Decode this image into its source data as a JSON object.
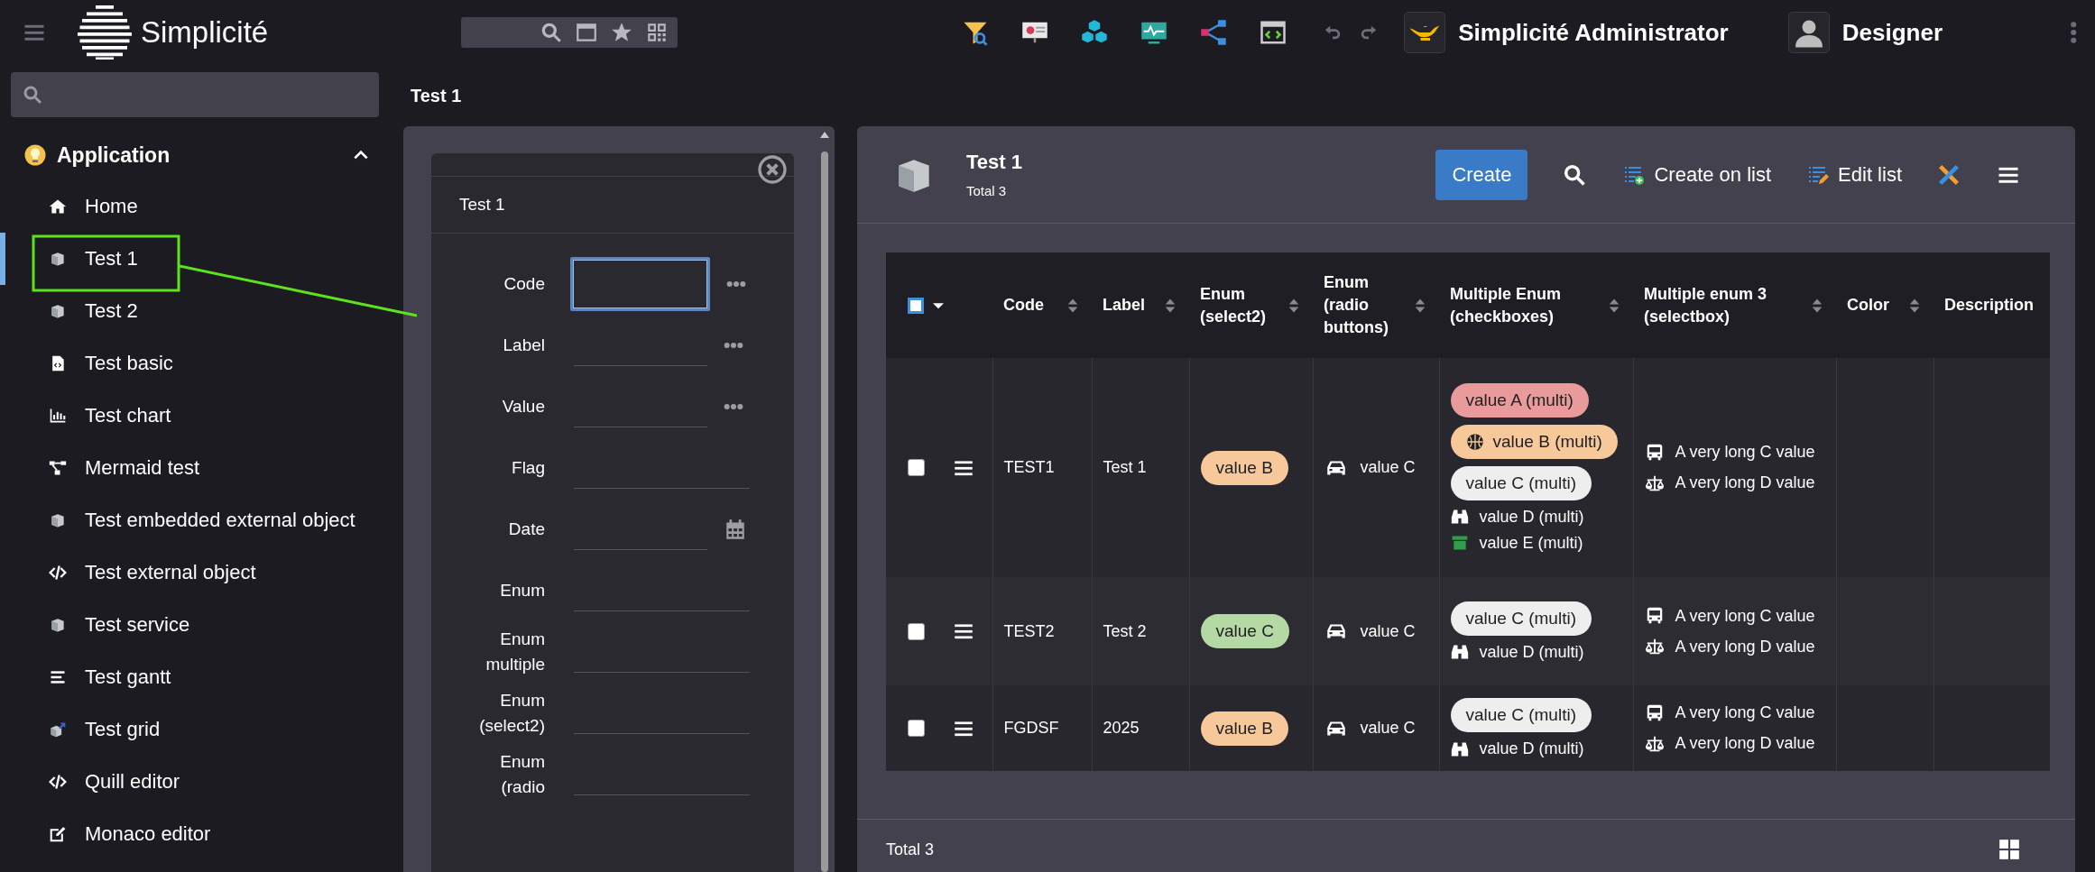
{
  "topbar": {
    "app_name": "Simplicité",
    "user_role": "Simplicité Administrator",
    "user_name": "Designer"
  },
  "sidebar": {
    "section": {
      "label": "Application",
      "expanded": true
    },
    "items": [
      {
        "label": "Home",
        "kind": "home",
        "selected": false
      },
      {
        "label": "Test 1",
        "kind": "cube",
        "selected": true
      },
      {
        "label": "Test 2",
        "kind": "cube",
        "selected": false
      },
      {
        "label": "Test basic",
        "kind": "file-code",
        "selected": false
      },
      {
        "label": "Test chart",
        "kind": "chart",
        "selected": false
      },
      {
        "label": "Mermaid test",
        "kind": "diagram",
        "selected": false
      },
      {
        "label": "Test embedded external object",
        "kind": "cube",
        "selected": false
      },
      {
        "label": "Test external object",
        "kind": "code",
        "selected": false
      },
      {
        "label": "Test service",
        "kind": "cube",
        "selected": false
      },
      {
        "label": "Test gantt",
        "kind": "gantt",
        "selected": false
      },
      {
        "label": "Test grid",
        "kind": "cube-arrow",
        "selected": false
      },
      {
        "label": "Quill editor",
        "kind": "code",
        "selected": false
      },
      {
        "label": "Monaco editor",
        "kind": "edit",
        "selected": false
      }
    ]
  },
  "breadcrumb": "Test 1",
  "form": {
    "title": "Test 1",
    "fields": [
      {
        "label": "Code",
        "focused": true,
        "kind": "more"
      },
      {
        "label": "Label",
        "focused": false,
        "kind": "more"
      },
      {
        "label": "Value",
        "focused": false,
        "kind": "more"
      },
      {
        "label": "Flag",
        "focused": false,
        "kind": "plain"
      },
      {
        "label": "Date",
        "focused": false,
        "kind": "calendar"
      },
      {
        "label": "Enum",
        "focused": false,
        "kind": "plain"
      },
      {
        "label": "Enum multiple",
        "focused": false,
        "kind": "plain"
      },
      {
        "label": "Enum (select2)",
        "focused": false,
        "kind": "plain"
      },
      {
        "label": "Enum (radio",
        "focused": false,
        "kind": "plain"
      }
    ]
  },
  "list": {
    "title": "Test 1",
    "count": "Total 3",
    "actions": [
      {
        "kind": "primary",
        "label": "Create"
      },
      {
        "kind": "search"
      },
      {
        "kind": "addlist",
        "label": "Create on list"
      },
      {
        "kind": "editlist",
        "label": "Edit list"
      },
      {
        "kind": "tools"
      },
      {
        "kind": "menu"
      }
    ],
    "select_all": {
      "checked": false
    },
    "columns": [
      {
        "label": "Code",
        "sortable": true
      },
      {
        "label": "Label",
        "sortable": true
      },
      {
        "label": "Enum (select2)",
        "sortable": true
      },
      {
        "label": "Enum (radio buttons)",
        "sortable": true
      },
      {
        "label": "Multiple Enum (checkboxes)",
        "sortable": true
      },
      {
        "label": "Multiple enum 3 (selectbox)",
        "sortable": true
      },
      {
        "label": "Color",
        "sortable": true
      },
      {
        "label": "Description",
        "sortable": false
      }
    ],
    "rows": [
      {
        "checked": false,
        "code": "TEST1",
        "label": "Test 1",
        "enum_select2": {
          "text": "value B",
          "color": "#f7c99a"
        },
        "enum_radio": {
          "text": "value C",
          "kind": "car"
        },
        "multiple_enum": [
          {
            "kind": "tag",
            "text": "value A (multi)",
            "color": "#e99b9b"
          },
          {
            "kind": "ball",
            "text": "value B (multi)",
            "color": "#f7c99a"
          },
          {
            "kind": "tag",
            "text": "value C (multi)",
            "color": "#eeeeee"
          },
          {
            "kind": "binoculars",
            "text": "value D (multi)"
          },
          {
            "kind": "archive",
            "text": "value E (multi)"
          }
        ],
        "multiple_enum_3": [
          {
            "text": "A very long C value",
            "kind": "bus"
          },
          {
            "text": "A very long D value",
            "kind": "scale"
          }
        ]
      },
      {
        "checked": false,
        "code": "TEST2",
        "label": "Test 2",
        "enum_select2": {
          "text": "value C",
          "color": "#b5d9a5"
        },
        "enum_radio": {
          "text": "value C",
          "kind": "car"
        },
        "multiple_enum": [
          {
            "kind": "tag",
            "text": "value C (multi)",
            "color": "#eeeeee"
          },
          {
            "kind": "binoculars",
            "text": "value D (multi)"
          }
        ],
        "multiple_enum_3": [
          {
            "text": "A very long C value",
            "kind": "bus"
          },
          {
            "text": "A very long D value",
            "kind": "scale"
          }
        ]
      },
      {
        "checked": false,
        "code": "FGDSF",
        "label": "2025",
        "enum_select2": {
          "text": "value B",
          "color": "#f7c99a"
        },
        "enum_radio": {
          "text": "value C",
          "kind": "car"
        },
        "multiple_enum": [
          {
            "kind": "tag",
            "text": "value C (multi)",
            "color": "#eeeeee"
          },
          {
            "kind": "binoculars",
            "text": "value D (multi)"
          }
        ],
        "multiple_enum_3": [
          {
            "text": "A very long C value",
            "kind": "bus"
          },
          {
            "text": "A very long D value",
            "kind": "scale"
          }
        ]
      }
    ],
    "footer": {
      "count": "Total 3"
    }
  }
}
